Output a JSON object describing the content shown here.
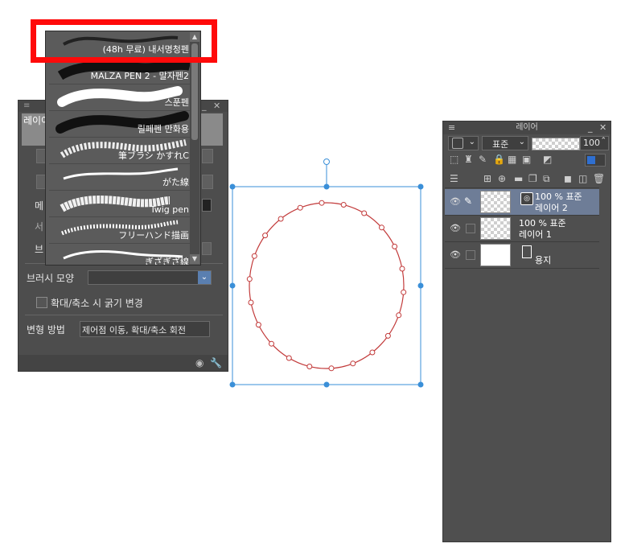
{
  "tool_property": {
    "tab_label": "레이어",
    "left_row_labels": [
      "메",
      "서",
      "브"
    ],
    "brush_shape_label": "브러시 모양",
    "brush_shape_value": "",
    "scale_checkbox_label": "확대/축소 시 굵기 변경",
    "transform_label": "변형 방법",
    "transform_value": "제어점 이동, 확대/축소 회전"
  },
  "brush_list": {
    "items": [
      {
        "label": "(48h 무료) 내서명청펜"
      },
      {
        "label": "MALZA PEN 2 - 말자펜2"
      },
      {
        "label": "스푼펜"
      },
      {
        "label": "릴페펜 만화용"
      },
      {
        "label": "筆ブラシ かすれC"
      },
      {
        "label": "がた線"
      },
      {
        "label": "Twig pen"
      },
      {
        "label": "フリーハンド描画"
      },
      {
        "label": "ぎざぎざ線"
      }
    ]
  },
  "layer_panel": {
    "title": "레이어",
    "blend_mode": "표준",
    "opacity": "100",
    "layers": [
      {
        "opacity_mode": "100 % 표준",
        "name": "레이어 2",
        "selected": true
      },
      {
        "opacity_mode": "100 % 표준",
        "name": "레이어 1",
        "selected": false
      },
      {
        "name": "용지",
        "selected": false
      }
    ]
  },
  "colors": {
    "highlight": "#ff0a0a",
    "selection_blue": "#3a8fd8",
    "circle_red": "#c23a3a",
    "panel_bg": "#4f4f4f"
  }
}
